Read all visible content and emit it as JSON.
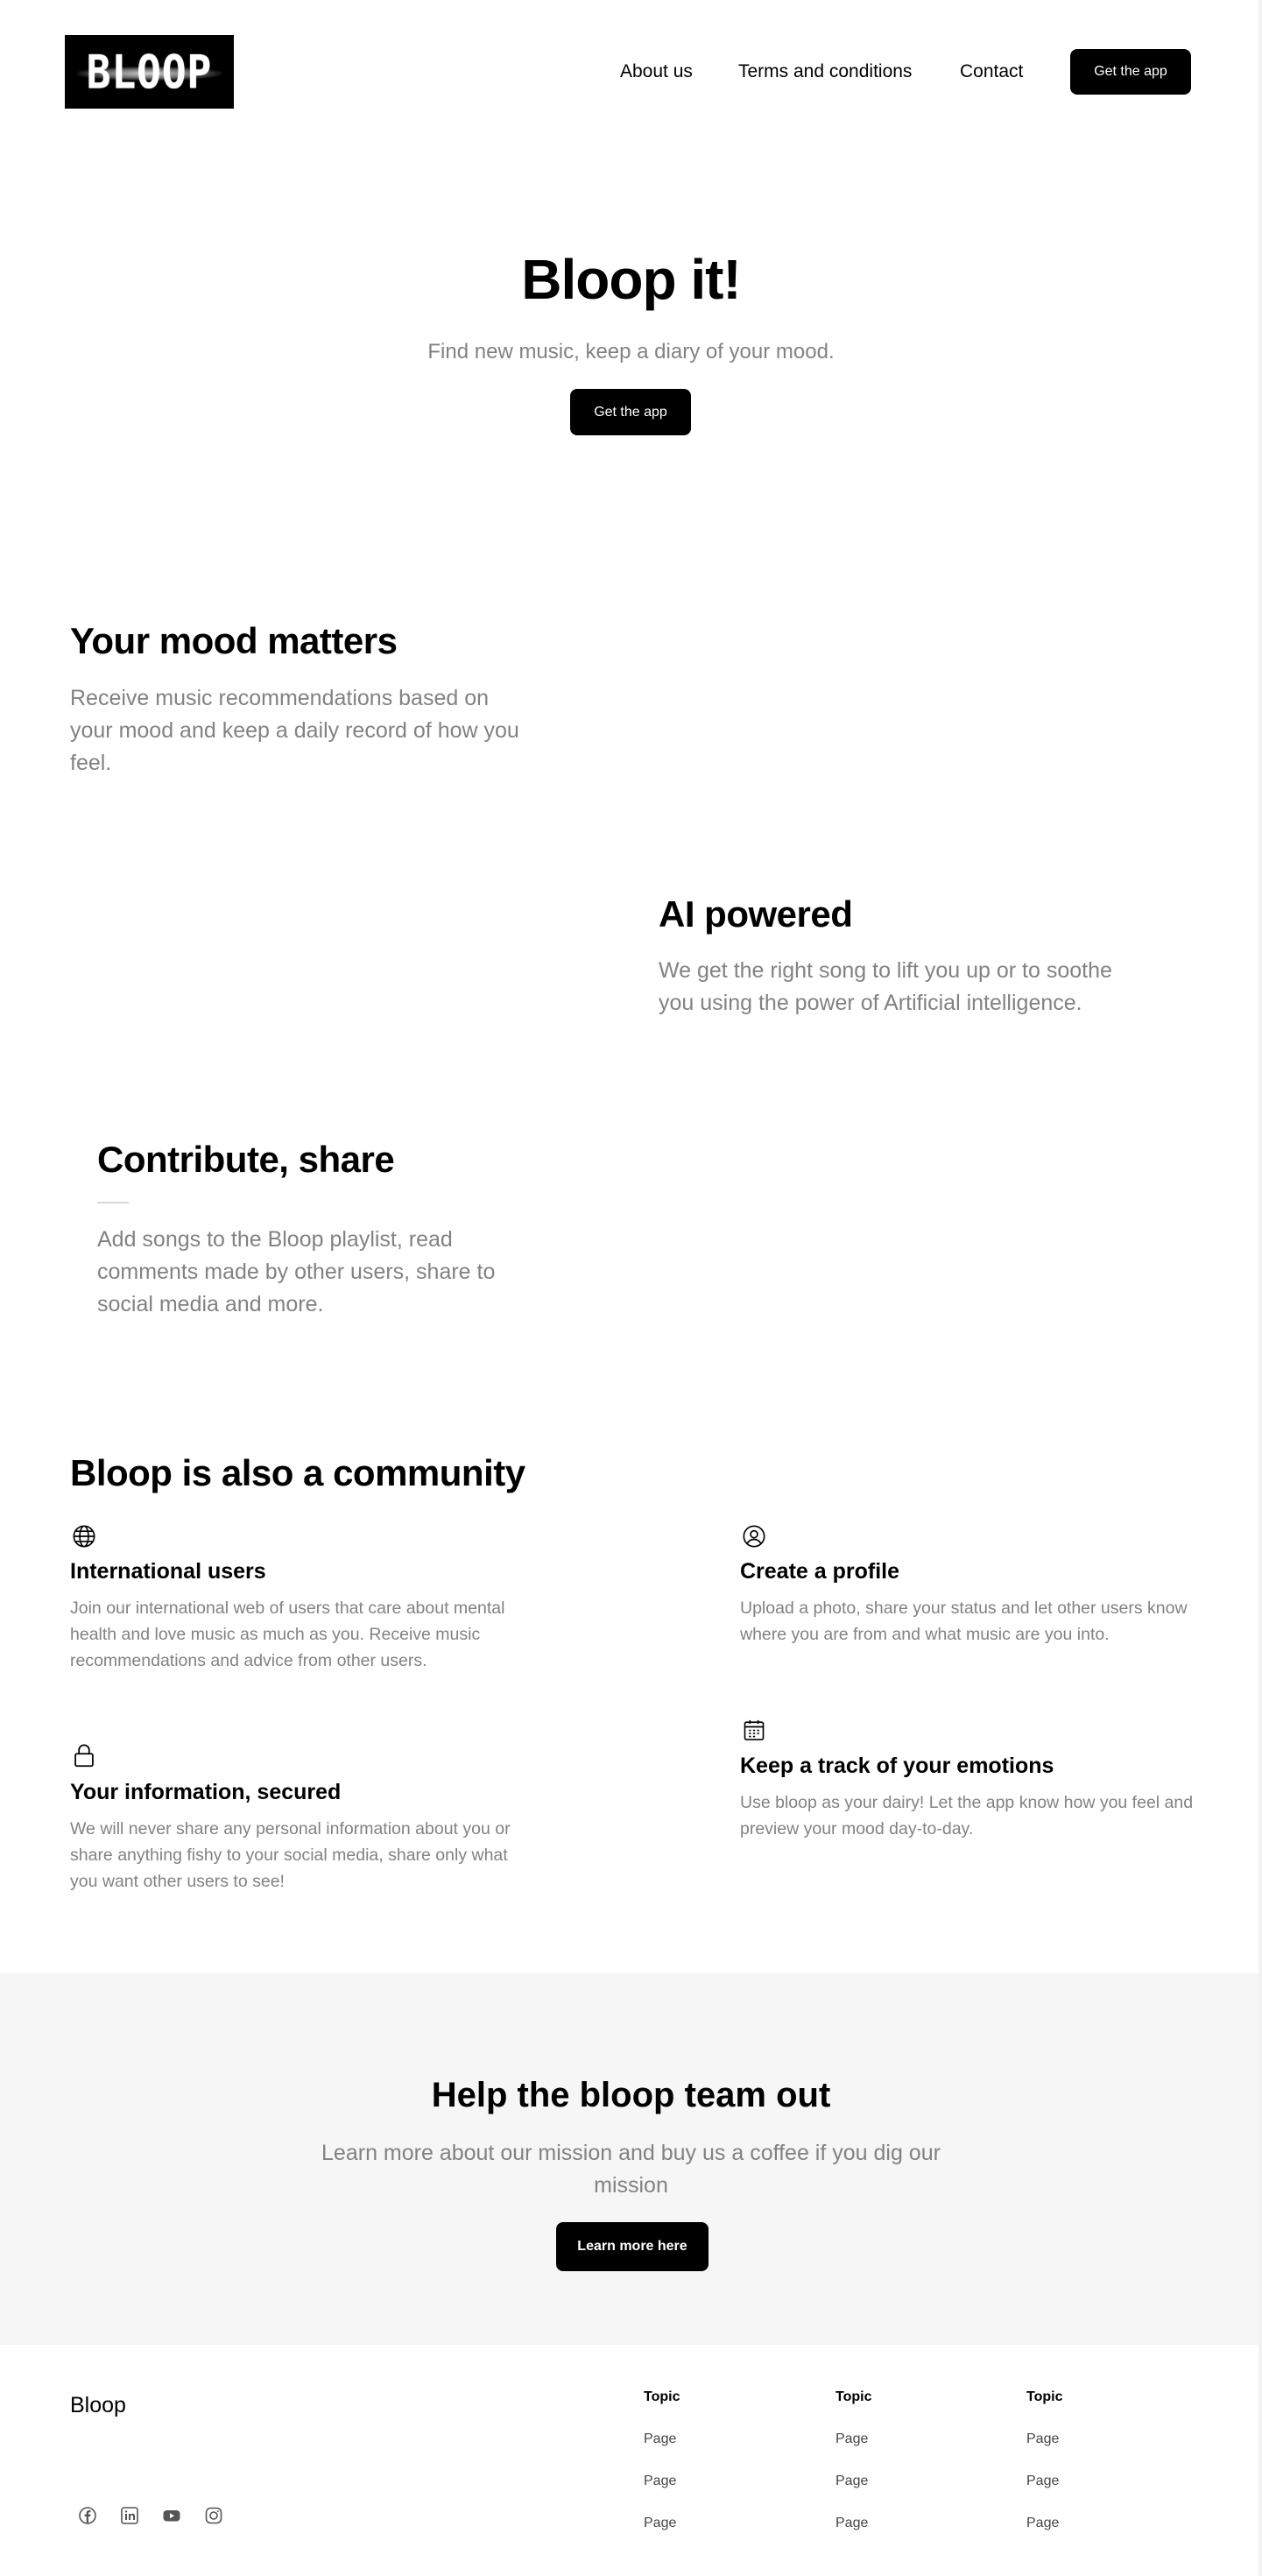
{
  "header": {
    "logo_text": "BLOOP",
    "nav": [
      {
        "label": "About us"
      },
      {
        "label": "Terms and conditions"
      },
      {
        "label": "Contact"
      }
    ],
    "cta_label": "Get the app"
  },
  "hero": {
    "title": "Bloop it!",
    "subtitle": "Find new music, keep a diary of your mood.",
    "cta_label": "Get the app"
  },
  "features": [
    {
      "title": "Your mood matters",
      "text": "Receive music recommendations based on your mood and keep a daily record of how you feel."
    },
    {
      "title": "AI powered",
      "text": "We get the right song to lift you up or to soothe you using the power of Artificial intelligence."
    },
    {
      "title": "Contribute, share",
      "text": "Add songs to the Bloop playlist, read comments made by other users, share to social media and more."
    }
  ],
  "community": {
    "title": "Bloop is also a community",
    "items": [
      {
        "icon": "globe-icon",
        "title": "International users",
        "text": "Join our international web of users that care about mental health and love music as much as you. Receive music recommendations and advice from other users."
      },
      {
        "icon": "user-circle-icon",
        "title": "Create a profile",
        "text": "Upload a photo, share your status and let other users know where you are from and what music are you into."
      },
      {
        "icon": "lock-icon",
        "title": "Your information, secured",
        "text": "We will never share any personal information about you or share anything fishy to your social media, share only what you want other users to see!"
      },
      {
        "icon": "calendar-icon",
        "title": "Keep a track of your emotions",
        "text": "Use bloop as your dairy! Let the app know how you feel and preview your mood day-to-day."
      }
    ]
  },
  "help": {
    "title": "Help the bloop team out",
    "subtitle": "Learn more about our mission and buy us a coffee if you dig our mission",
    "cta_label": "Learn more here"
  },
  "footer": {
    "brand": "Bloop",
    "social_icons": [
      "facebook-icon",
      "linkedin-icon",
      "youtube-icon",
      "instagram-icon"
    ],
    "columns": [
      {
        "topic": "Topic",
        "pages": [
          "Page",
          "Page",
          "Page"
        ]
      },
      {
        "topic": "Topic",
        "pages": [
          "Page",
          "Page",
          "Page"
        ]
      },
      {
        "topic": "Topic",
        "pages": [
          "Page",
          "Page",
          "Page"
        ]
      }
    ]
  },
  "colors": {
    "primary": "#000000",
    "muted_text": "#828282",
    "section_bg": "#f6f6f6",
    "background": "#ffffff"
  }
}
